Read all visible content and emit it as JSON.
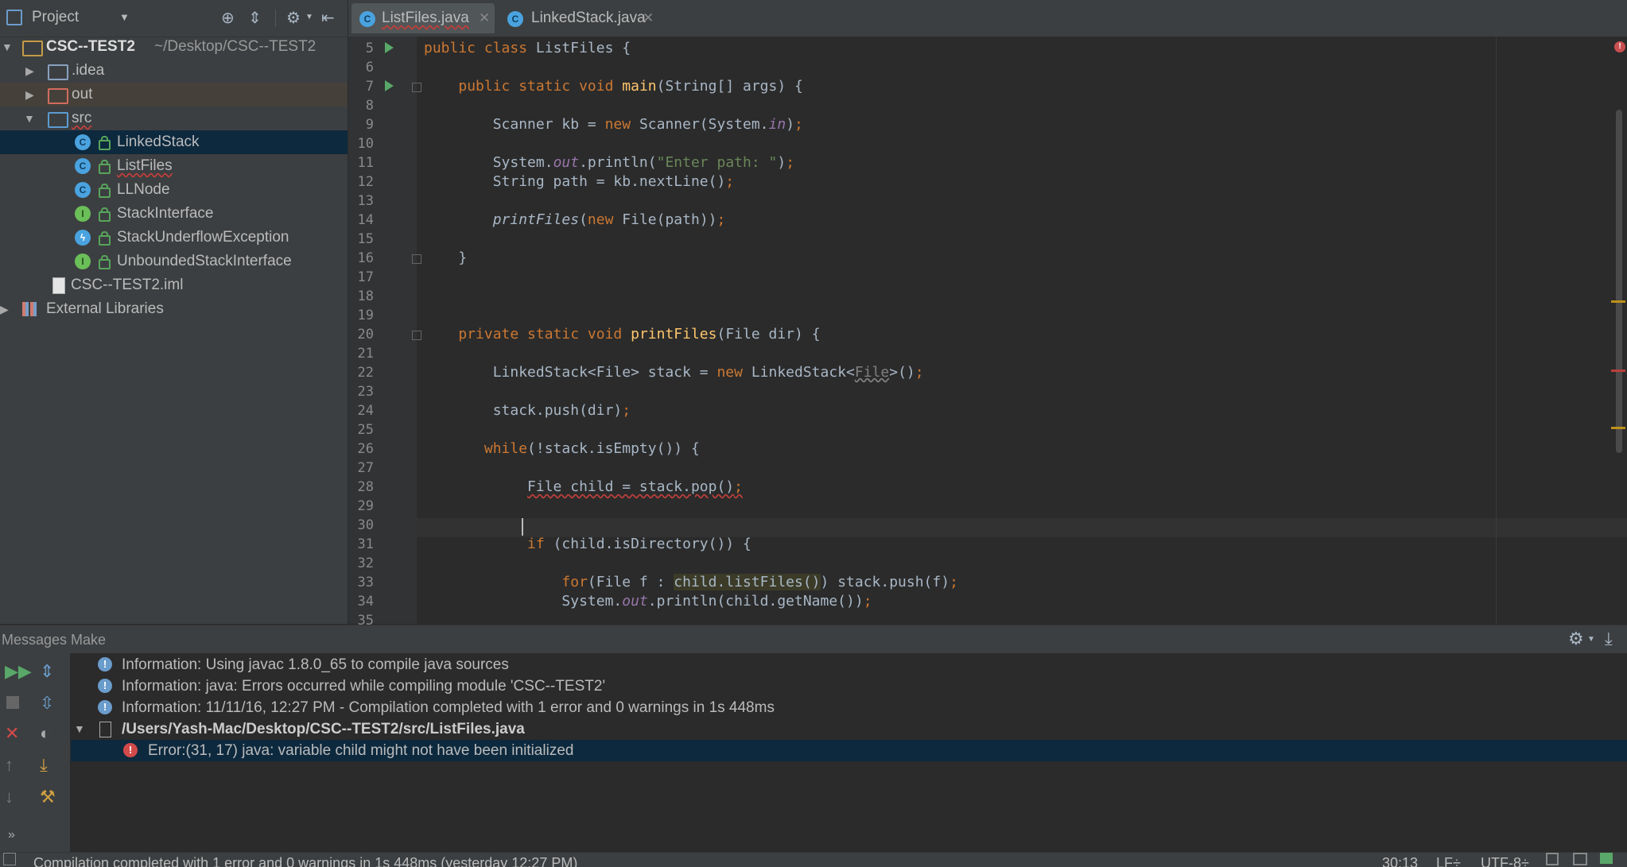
{
  "project_panel": {
    "title": "Project",
    "root": {
      "name": "CSC--TEST2",
      "path": "~/Desktop/CSC--TEST2"
    },
    "items": [
      {
        "label": ".idea"
      },
      {
        "label": "out"
      },
      {
        "label": "src"
      },
      {
        "label": "LinkedStack"
      },
      {
        "label": "ListFiles"
      },
      {
        "label": "LLNode"
      },
      {
        "label": "StackInterface"
      },
      {
        "label": "StackUnderflowException"
      },
      {
        "label": "UnboundedStackInterface"
      },
      {
        "label": "CSC--TEST2.iml"
      },
      {
        "label": "External Libraries"
      }
    ]
  },
  "editor": {
    "tabs": [
      {
        "label": "ListFiles.java"
      },
      {
        "label": "LinkedStack.java"
      }
    ],
    "line_numbers": [
      "5",
      "6",
      "7",
      "8",
      "9",
      "10",
      "11",
      "12",
      "13",
      "14",
      "15",
      "16",
      "17",
      "18",
      "19",
      "20",
      "21",
      "22",
      "23",
      "24",
      "25",
      "26",
      "27",
      "28",
      "29",
      "30",
      "31",
      "32",
      "33",
      "34",
      "35"
    ]
  },
  "messages": {
    "title": "Messages Make",
    "rows": [
      "Information: Using javac 1.8.0_65 to compile java sources",
      "Information: java: Errors occurred while compiling module 'CSC--TEST2'",
      "Information: 11/11/16, 12:27 PM - Compilation completed with 1 error and 0 warnings in 1s 448ms",
      "/Users/Yash-Mac/Desktop/CSC--TEST2/src/ListFiles.java",
      "Error:(31, 17)  java: variable child might not have been initialized"
    ]
  },
  "status_bar": {
    "message": "Compilation completed with 1 error and 0 warnings in 1s 448ms (yesterday 12:27 PM)",
    "position": "30:13",
    "line_sep": "LF÷",
    "encoding": "UTF-8÷"
  }
}
